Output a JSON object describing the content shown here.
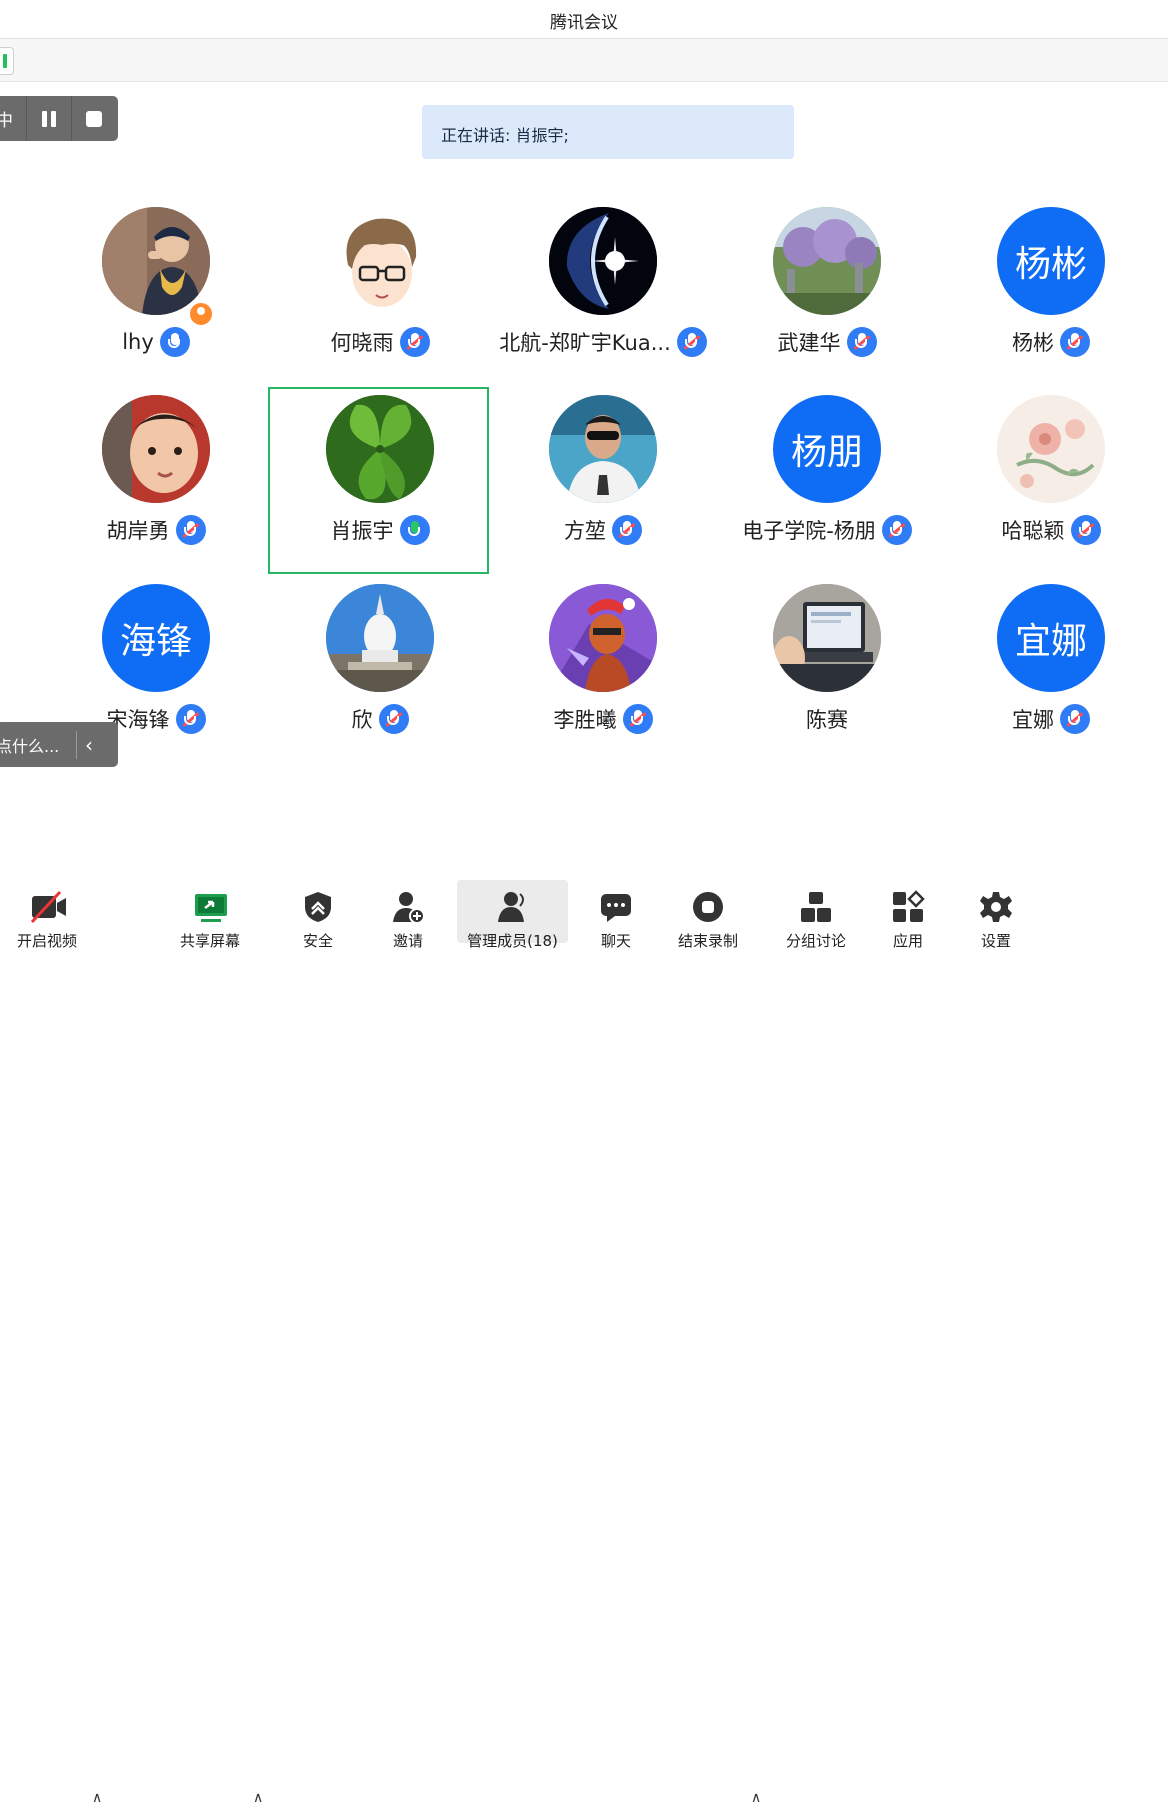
{
  "window": {
    "title": "腾讯会议"
  },
  "recording": {
    "status_text": "中"
  },
  "speaking": {
    "text": "正在讲话: 肖振宇;"
  },
  "members": [
    {
      "name": "lhy",
      "avatar": "photo-person-scarf",
      "mic": "on",
      "host": true
    },
    {
      "name": "何晓雨",
      "avatar": "cartoon-boy-glasses",
      "mic": "muted"
    },
    {
      "name": "北航-郑旷宇Kua...",
      "avatar": "crescent-space",
      "mic": "muted"
    },
    {
      "name": "武建华",
      "avatar": "wisteria-photo",
      "mic": "muted"
    },
    {
      "name": "杨彬",
      "avatar_text": "杨彬",
      "mic": "muted"
    },
    {
      "name": "胡岸勇",
      "avatar": "baby-photo",
      "mic": "muted"
    },
    {
      "name": "肖振宇",
      "avatar": "clover-photo",
      "mic": "speaking",
      "active": true
    },
    {
      "name": "方堃",
      "avatar": "man-sunglasses-aquarium",
      "mic": "muted"
    },
    {
      "name": "电子学院-杨朋",
      "avatar_text": "杨朋",
      "mic": "muted"
    },
    {
      "name": "哈聪颖",
      "avatar": "flower-painting",
      "mic": "muted"
    },
    {
      "name": "宋海锋",
      "avatar_text": "海锋",
      "mic": "muted"
    },
    {
      "name": "欣",
      "avatar": "white-pagoda-photo",
      "mic": "muted"
    },
    {
      "name": "李胜曦",
      "avatar": "game-character-santa-hat",
      "mic": "muted"
    },
    {
      "name": "陈赛",
      "avatar": "laptop-child-photo",
      "mic": "none"
    },
    {
      "name": "宜娜",
      "avatar_text": "宜娜",
      "mic": "muted"
    }
  ],
  "chat": {
    "placeholder": "点什么...",
    "collapse_icon": "chevron-left-icon"
  },
  "toolbar": {
    "video": "开启视频",
    "share": "共享屏幕",
    "security": "安全",
    "invite": "邀请",
    "members": "管理成员(18)",
    "chat": "聊天",
    "end_record": "结束录制",
    "breakout": "分组讨论",
    "apps": "应用",
    "settings": "设置"
  },
  "colors": {
    "accent": "#0e6cf5",
    "speaking_frame": "#25b864",
    "mic": "#2f7cf6"
  }
}
